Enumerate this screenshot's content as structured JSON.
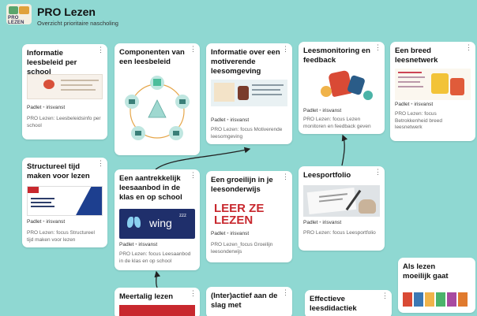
{
  "header": {
    "title": "PRO Lezen",
    "subtitle": "Overzicht prioritaire nascholing",
    "logo_text": "PRO LEZEN"
  },
  "cards": {
    "c1": {
      "title": "Informatie leesbeleid per school",
      "meta_source": "Padlet",
      "meta_author": "irisvanst",
      "desc": "PRO Lezen: Leesbeleidsinfo per school"
    },
    "c2": {
      "title": "Componenten van een leesbeleid"
    },
    "c3": {
      "title": "Informatie over een motiverende leesomgeving",
      "meta_source": "Padlet",
      "meta_author": "irisvanst",
      "desc": "PRO Lezen: focus Motiverende leesomgeving"
    },
    "c4": {
      "title": "Leesmonitoring en feedback",
      "meta_source": "Padlet",
      "meta_author": "irisvanst",
      "desc": "PRO Lezen: focus Lezen monitoren en feedback geven"
    },
    "c5": {
      "title": "Een breed leesnetwerk",
      "meta_source": "Padlet",
      "meta_author": "irisvanst",
      "desc": "PRO Lezen: focus Betrokkenheid breed leesnetwerk"
    },
    "c6": {
      "title": "Structureel tijd maken voor lezen",
      "meta_source": "Padlet",
      "meta_author": "irisvanst",
      "desc": "PRO Lezen: focus Structureel tijd maken voor lezen"
    },
    "c7": {
      "title": "Een aantrekkelijk leesaanbod in de klas en op school",
      "meta_source": "Padlet",
      "meta_author": "irisvanst",
      "desc": "PRO Lezen: focus Leesaanbod in de klas en op school",
      "thumb_text": "wing"
    },
    "c8": {
      "title": "Een groeilijn in je leesonderwijs",
      "meta_source": "Padlet",
      "meta_author": "irisvanst",
      "desc": "PRO Lezen_focus Groeilijn leesonderwijs",
      "thumb_text": "LEER ZE LEZEN"
    },
    "c9": {
      "title": "Leesportfolio",
      "meta_source": "Padlet",
      "meta_author": "irisvanst",
      "desc": "PRO Lezen: focus Leesportfolio"
    },
    "c10": {
      "title": "Als lezen moeilijk gaat"
    },
    "c11": {
      "title": "Meertalig lezen"
    },
    "c12": {
      "title": "(Inter)actief aan de slag met"
    },
    "c13": {
      "title": "Effectieve leesdidactiek"
    }
  },
  "icons": {
    "kebab": "⋮"
  },
  "colors": {
    "background": "#8fd8d2",
    "card": "#ffffff",
    "arrow": "#222222",
    "accent_red": "#c8282e",
    "wing_blue": "#1f2f6b"
  }
}
